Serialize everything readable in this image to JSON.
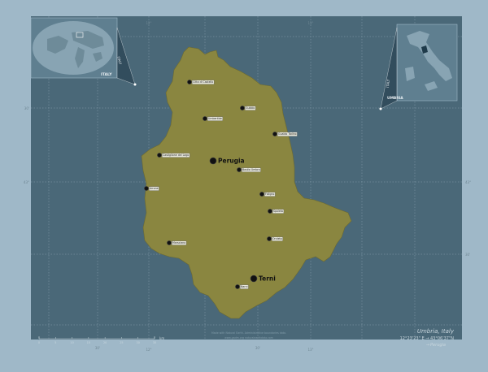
{
  "map": {
    "region": "Umbria",
    "country": "Italy",
    "title": "Umbria, Italy",
    "coords": "12°23'23\" E → 43°06'37\"N",
    "coords_arrow": "→",
    "capital": "Perugia",
    "fill_color": "#8a8640",
    "ocean_color": "#7491a1",
    "cities": [
      {
        "name": "Citta di Castello",
        "kind": "town"
      },
      {
        "name": "Gubbio",
        "kind": "town"
      },
      {
        "name": "Umbertide",
        "kind": "town"
      },
      {
        "name": "Gualdo Tadino",
        "kind": "town"
      },
      {
        "name": "Castiglione del Lago",
        "kind": "town"
      },
      {
        "name": "Perugia",
        "kind": "capital"
      },
      {
        "name": "Bastia Umbra",
        "kind": "town"
      },
      {
        "name": "Foligno",
        "kind": "town"
      },
      {
        "name": "Spoleto",
        "kind": "town"
      },
      {
        "name": "Marsciano",
        "kind": "town"
      },
      {
        "name": "Orvieto",
        "kind": "town"
      },
      {
        "name": "Terni",
        "kind": "capital"
      },
      {
        "name": "Narni",
        "kind": "town"
      },
      {
        "name": "Arrone",
        "kind": "town"
      }
    ],
    "lon_ticks": [
      "12°",
      "13°"
    ],
    "lat_ticks": [
      "43°"
    ],
    "small_ticks": [
      "30'",
      "30'",
      "30'",
      "30'"
    ],
    "scale": {
      "ticks": [
        "0",
        "5",
        "10",
        "15",
        "20",
        "25",
        "30",
        "35"
      ],
      "unit": "km"
    },
    "footer_note": "Made with Natural Earth. Administrative boundaries data.",
    "footer_credit": "www.gadm.org  naturalearthdata.com",
    "inset_world": {
      "label": "ITALY",
      "arrow": "→"
    },
    "inset_italy": {
      "labels": [
        "ITALY",
        "UMBRIA"
      ]
    }
  }
}
